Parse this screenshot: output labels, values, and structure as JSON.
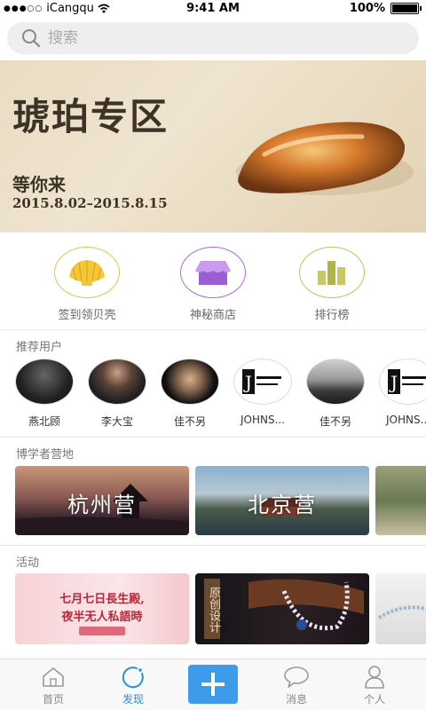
{
  "status_bar": {
    "carrier": "iCangqu",
    "time": "9:41 AM",
    "battery": "100%"
  },
  "search": {
    "placeholder": "搜索"
  },
  "banner": {
    "title": "琥珀专区",
    "subtitle": "等你来",
    "date_range": "2015.8.02–2015.8.15"
  },
  "quick_entries": [
    {
      "label": "签到领贝壳",
      "icon": "shell-icon",
      "color": "#e6c24a"
    },
    {
      "label": "神秘商店",
      "icon": "shop-icon",
      "color": "#a86bd8"
    },
    {
      "label": "排行榜",
      "icon": "ranking-icon",
      "color": "#bfc25a"
    }
  ],
  "recommended_users": {
    "title": "推荐用户",
    "users": [
      {
        "name": "燕北顾"
      },
      {
        "name": "李大宝"
      },
      {
        "name": "佳不另"
      },
      {
        "name": "JOHNS..."
      },
      {
        "name": "佳不另"
      },
      {
        "name": "JOHNS..."
      }
    ]
  },
  "camps": {
    "title": "博学者营地",
    "items": [
      {
        "name": "杭州营"
      },
      {
        "name": "北京营"
      },
      {
        "name": ""
      }
    ]
  },
  "activities": {
    "title": "活动",
    "items": [
      {
        "line1": "七月七日長生殿,",
        "line2": "夜半无人私語時"
      },
      {
        "line1": "原创设计"
      },
      {
        "line1": ""
      }
    ]
  },
  "tabbar": {
    "tabs": [
      {
        "label": "首页",
        "icon": "home-icon"
      },
      {
        "label": "发现",
        "icon": "discover-icon",
        "active": true
      },
      {
        "label": "",
        "icon": "plus-icon"
      },
      {
        "label": "消息",
        "icon": "message-icon"
      },
      {
        "label": "个人",
        "icon": "profile-icon"
      }
    ]
  },
  "colors": {
    "accent": "#2b8fd9",
    "plus_button": "#3d9be9"
  }
}
